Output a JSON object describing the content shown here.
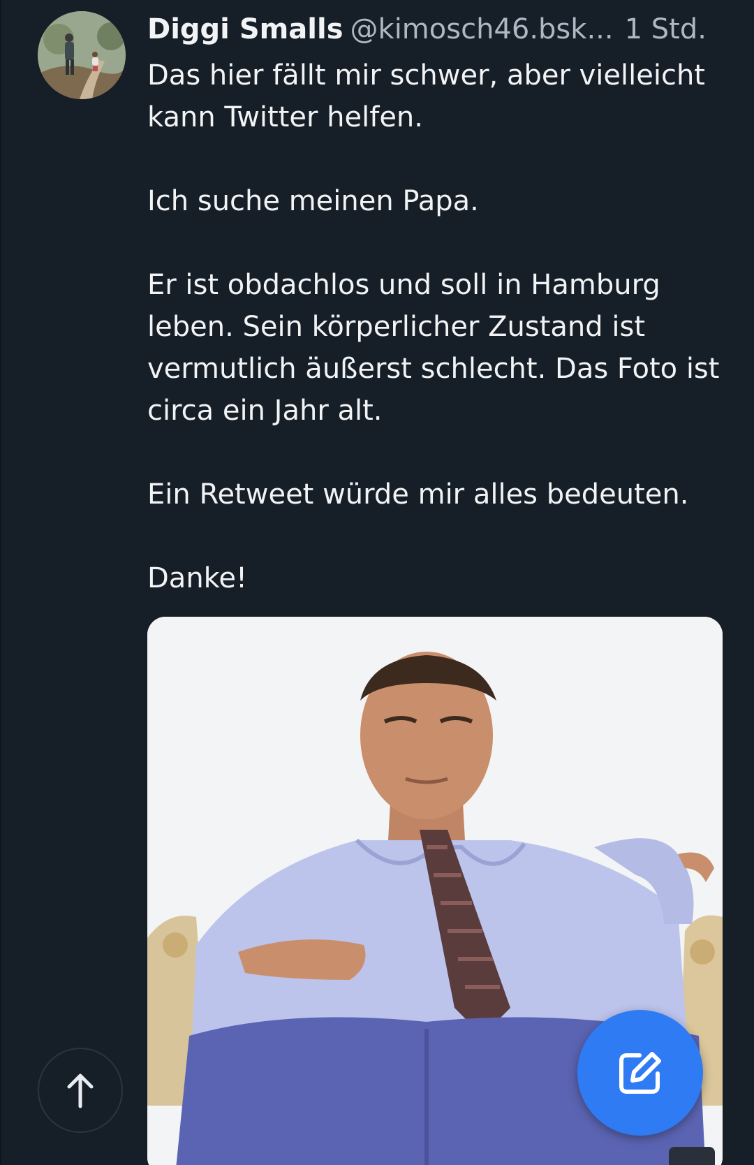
{
  "post": {
    "display_name": "Diggi Smalls",
    "handle": "@kimosch46.bsk...",
    "time": "1 Std.",
    "paragraphs": [
      "Das hier fällt mir schwer, aber vielleicht kann Twitter helfen.",
      "Ich suche meinen Papa.",
      "Er ist obdachlos und soll in Hamburg leben. Sein körperlicher Zustand ist vermutlich äußerst schlecht. Das Foto ist circa ein Jahr alt.",
      "Ein Retweet würde mir alles bedeuten.",
      "Danke!"
    ]
  },
  "icons": {
    "scroll_top": "arrow-up-icon",
    "compose": "edit-icon"
  },
  "colors": {
    "background": "#161e27",
    "text_primary": "#f1f3f5",
    "text_secondary": "#aeb8c4",
    "accent": "#2f7bf3"
  }
}
